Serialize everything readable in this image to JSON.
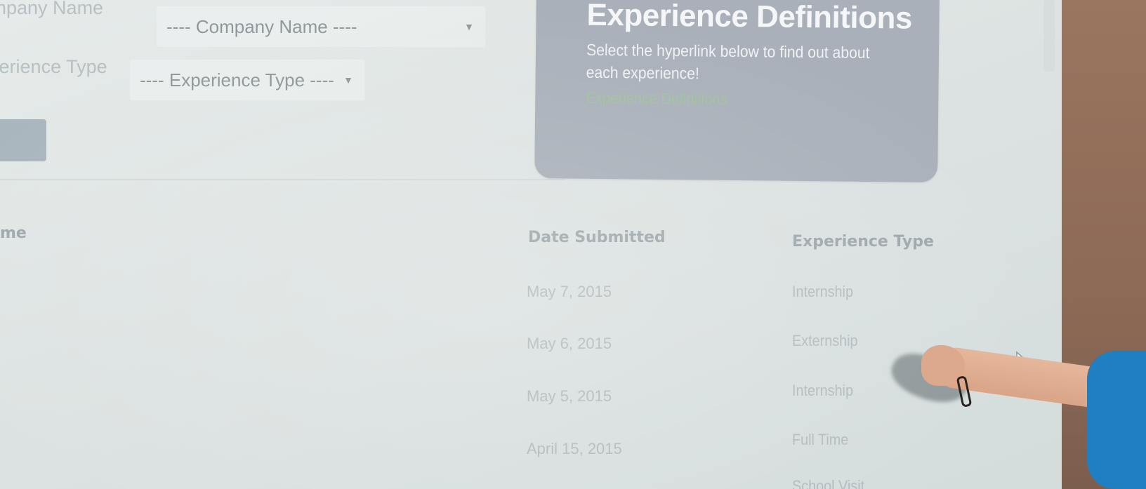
{
  "filters": {
    "company_label": "Company Name",
    "company_select": "---- Company Name ----",
    "type_label": "Experience Type",
    "type_select": "---- Experience Type ----"
  },
  "promo": {
    "title": "Experience Definitions",
    "text": "Select the hyperlink below to find out about each experience!",
    "link": "Experience Definitions"
  },
  "table": {
    "headers": [
      "me",
      "Date Submitted",
      "Experience Type"
    ],
    "rows": [
      {
        "date": "May 7, 2015",
        "type": "Internship"
      },
      {
        "date": "May 6, 2015",
        "type": "Externship"
      },
      {
        "date": "May 5, 2015",
        "type": "Internship"
      },
      {
        "date": "April 15, 2015",
        "type": "Full Time"
      },
      {
        "date": "",
        "type": "School Visit"
      }
    ]
  },
  "icons": {
    "caret": "dropdown-caret-icon",
    "cursor": "mouse-pointer-icon"
  },
  "colors": {
    "promo_bg": "#a9b0b9",
    "link": "#9fc29b",
    "sleeve": "#1f7fc1"
  }
}
